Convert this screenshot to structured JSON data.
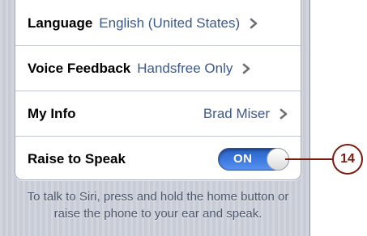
{
  "settings": {
    "rows": [
      {
        "label": "Language",
        "value": "English (United States)"
      },
      {
        "label": "Voice Feedback",
        "value": "Handsfree Only"
      },
      {
        "label": "My Info",
        "value": "Brad Miser"
      },
      {
        "label": "Raise to Speak",
        "toggle": "ON"
      }
    ],
    "footer": "To talk to Siri, press and hold the home button or raise the phone to your ear and speak."
  },
  "callout": {
    "number": "14"
  },
  "colors": {
    "value_text": "#3b5a8c",
    "toggle_on": "#3d7ae0",
    "callout": "#7a1a0e",
    "background": "#c8ccd6"
  },
  "icons": {
    "disclosure": "chevron-right-icon"
  }
}
